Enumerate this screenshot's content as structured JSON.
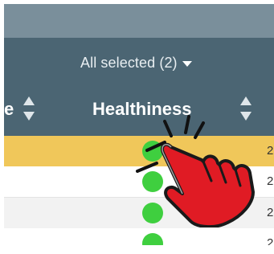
{
  "table": {
    "filter_label": "All selected (2)",
    "columns": {
      "left_partial": "e",
      "healthiness": "Healthiness"
    },
    "rows": [
      {
        "status_color": "#3fcf3f",
        "trailing": "2",
        "selected": true
      },
      {
        "status_color": "#3fcf3f",
        "trailing": "2",
        "selected": false
      },
      {
        "status_color": "#3fcf3f",
        "trailing": "2",
        "selected": false
      },
      {
        "status_color": "#3fcf3f",
        "trailing": "2",
        "selected": false
      }
    ]
  },
  "colors": {
    "header_bg": "#4b6573",
    "top_band": "#7a8f9b",
    "selected_row": "#f0c75a",
    "status_green": "#3fcf3f",
    "pointer_red": "#e01b24"
  },
  "icons": {
    "sort": "sort-arrows-icon",
    "filter_caret": "caret-down-icon",
    "pointer": "click-hand-icon"
  }
}
